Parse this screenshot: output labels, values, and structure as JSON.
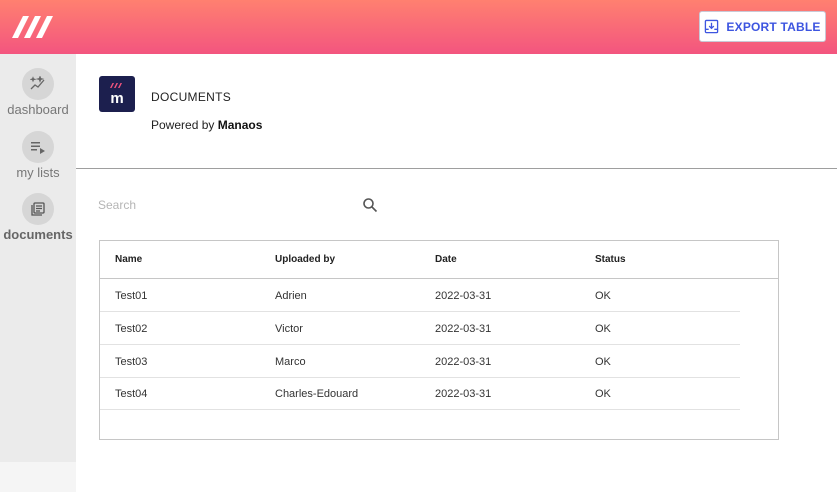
{
  "header": {
    "logo_icon": "manaos-stripes-logo",
    "export_label": "EXPORT TABLE",
    "export_icon": "download-tray-icon",
    "accent_color": "#3d55e0"
  },
  "sidebar": {
    "items": [
      {
        "label": "dashboard",
        "icon": "sparkle-chart-icon",
        "active": false
      },
      {
        "label": "my lists",
        "icon": "playlist-icon",
        "active": false
      },
      {
        "label": "documents",
        "icon": "library-icon",
        "active": true
      }
    ]
  },
  "main": {
    "brand_icon": "manaos-m-logo",
    "title": "DOCUMENTS",
    "powered_prefix": "Powered by",
    "powered_brand": "Manaos",
    "search": {
      "placeholder": "Search",
      "value": "",
      "icon": "search-icon"
    },
    "table": {
      "columns": [
        "Name",
        "Uploaded by",
        "Date",
        "Status"
      ],
      "rows": [
        [
          "Test01",
          "Adrien",
          "2022-03-31",
          "OK"
        ],
        [
          "Test02",
          "Victor",
          "2022-03-31",
          "OK"
        ],
        [
          "Test03",
          "Marco",
          "2022-03-31",
          "OK"
        ],
        [
          "Test04",
          "Charles-Edouard",
          "2022-03-31",
          "OK"
        ]
      ]
    }
  }
}
